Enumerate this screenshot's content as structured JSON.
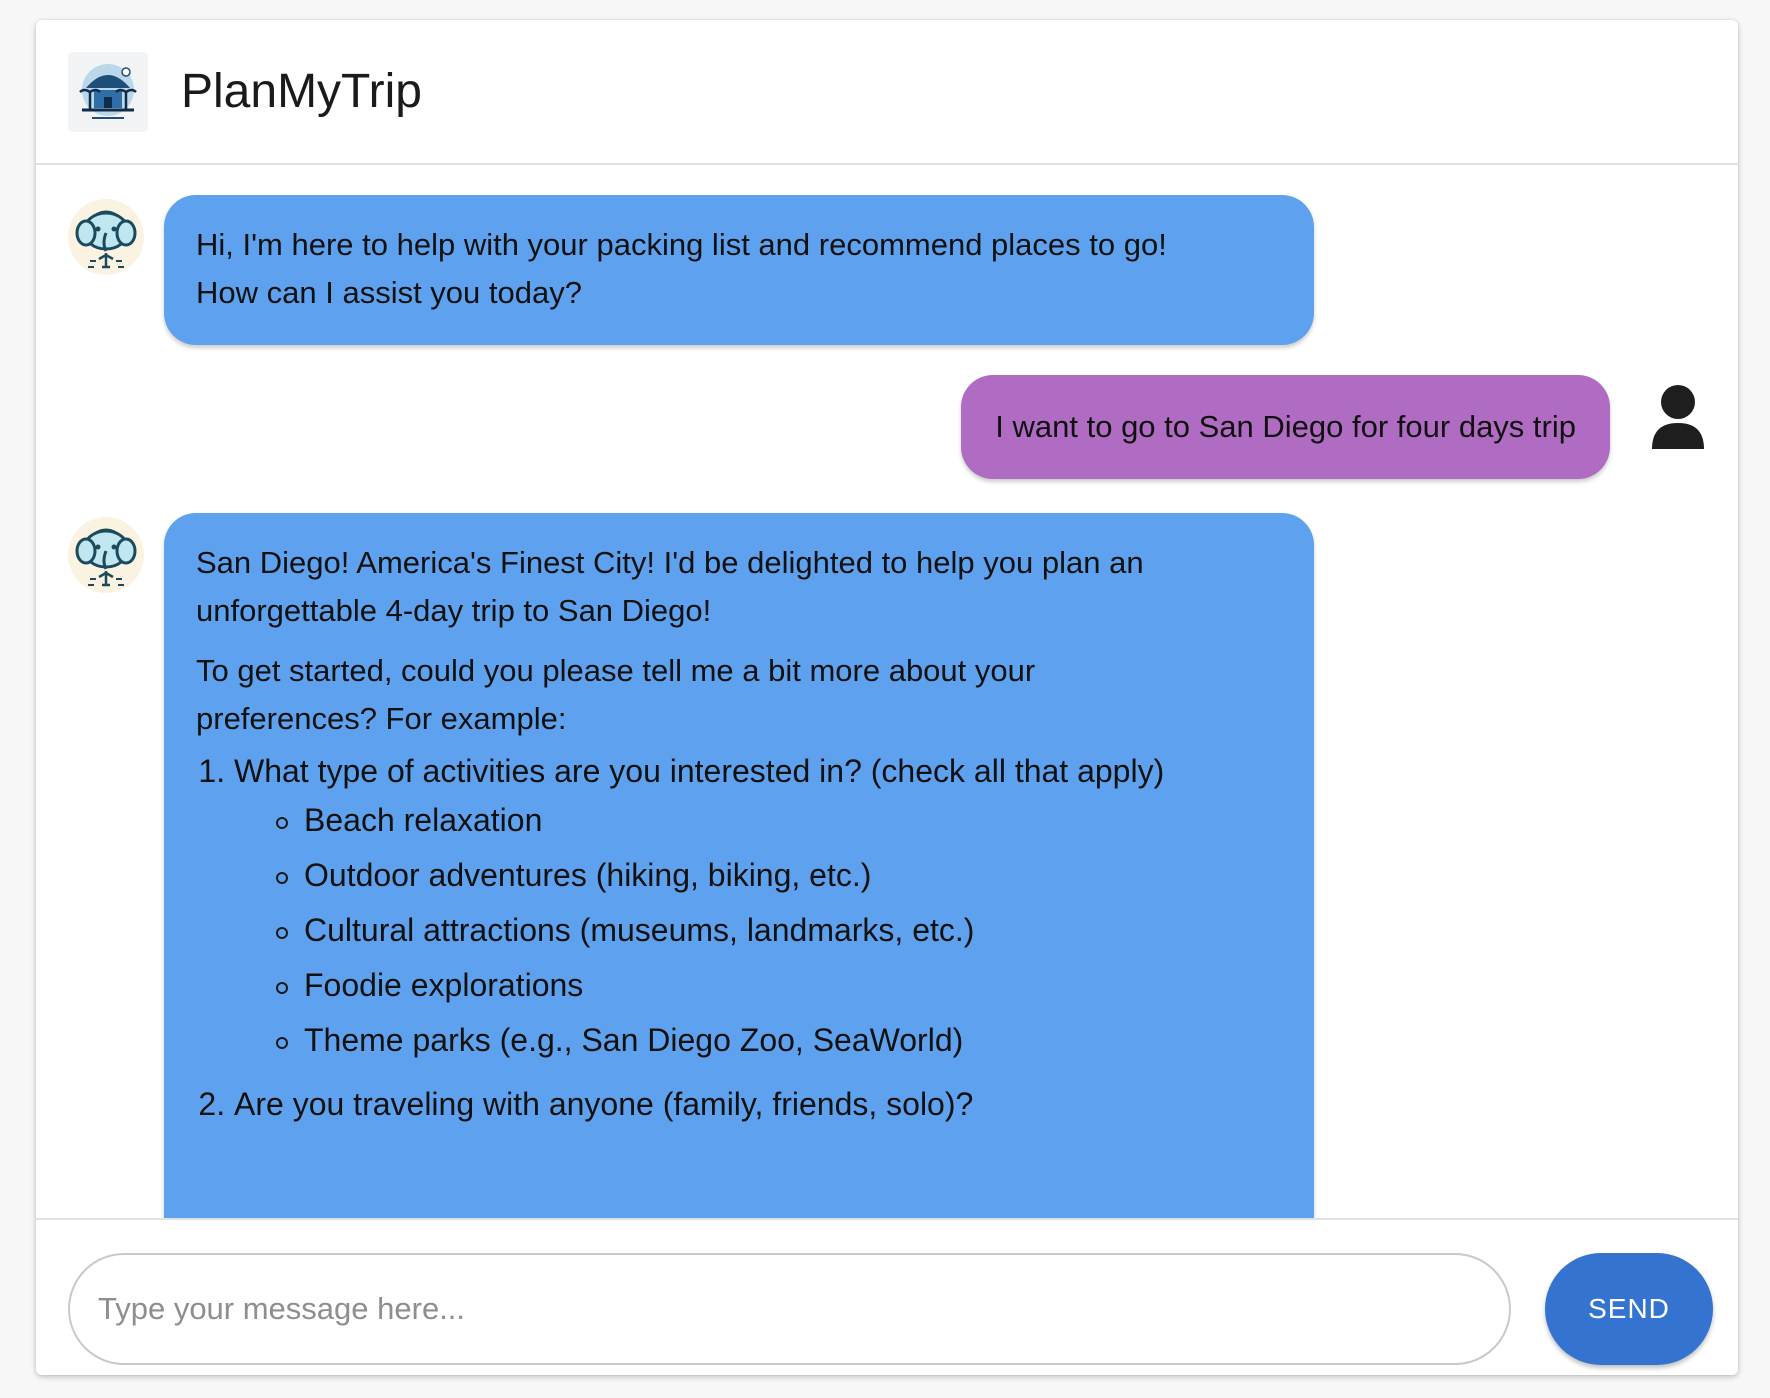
{
  "app": {
    "title": "PlanMyTrip"
  },
  "colors": {
    "bot_bubble": "#5ea2ef",
    "user_bubble": "#b06cc3",
    "send_button": "#3474d0"
  },
  "messages": [
    {
      "sender": "bot",
      "avatar_icon": "elephant-bot-icon",
      "lines": [
        "Hi, I'm here to help with your packing list and recommend places to go!",
        "How can I assist you today?"
      ]
    },
    {
      "sender": "user",
      "avatar_icon": "user-icon",
      "text": "I want to go to San Diego for four days trip"
    },
    {
      "sender": "bot",
      "avatar_icon": "elephant-bot-icon",
      "paragraph_1_lines": [
        "San Diego! America's Finest City! I'd be delighted to help you plan an",
        "unforgettable 4-day trip to San Diego!"
      ],
      "paragraph_2_lines": [
        "To get started, could you please tell me a bit more about your",
        "preferences? For example:"
      ],
      "questions": [
        {
          "text": "What type of activities are you interested in? (check all that apply)",
          "options": [
            "Beach relaxation",
            "Outdoor adventures (hiking, biking, etc.)",
            "Cultural attractions (museums, landmarks, etc.)",
            "Foodie explorations",
            "Theme parks (e.g., San Diego Zoo, SeaWorld)"
          ]
        },
        {
          "text": "Are you traveling with anyone (family, friends, solo)?"
        }
      ]
    }
  ],
  "composer": {
    "placeholder": "Type your message here...",
    "send_label": "SEND"
  }
}
